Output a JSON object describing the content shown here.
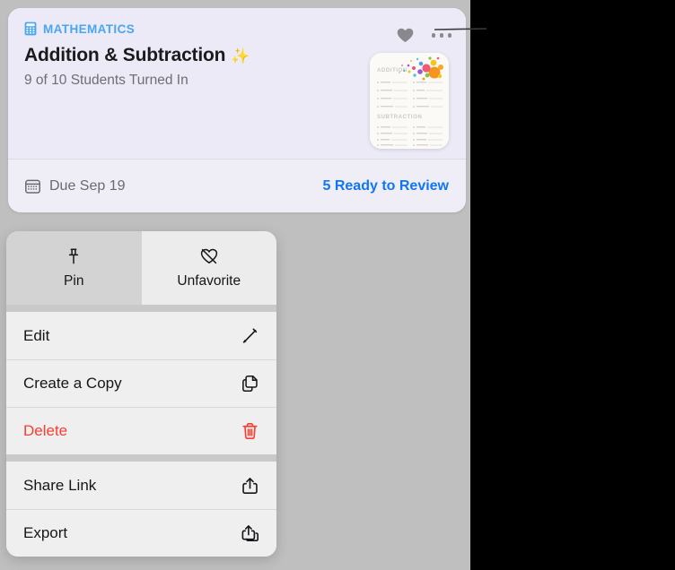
{
  "card": {
    "subject_icon": "calculator-icon",
    "subject": "MATHEMATICS",
    "title": "Addition & Subtraction",
    "title_emoji": "✨",
    "subtitle": "9 of 10 Students Turned In",
    "favorite_icon": "heart-icon",
    "more_icon": "ellipsis-icon",
    "footer": {
      "calendar_icon": "calendar-icon",
      "due": "Due Sep 19",
      "review_link": "5 Ready to Review"
    },
    "thumbnail": {
      "section_1": "ADDITION",
      "section_2": "SUBTRACTION"
    },
    "colors": {
      "background": "#eceaf6",
      "subject_blue": "#49a6f0",
      "link_blue": "#1175f5",
      "title": "#1b1b1d",
      "subtitle": "#6e6e73"
    }
  },
  "context_menu": {
    "tiles": [
      {
        "label": "Pin",
        "icon": "pin-icon",
        "selected": true
      },
      {
        "label": "Unfavorite",
        "icon": "heart-slash-icon",
        "selected": false
      }
    ],
    "group_1": [
      {
        "label": "Edit",
        "icon": "pencil-icon",
        "danger": false
      },
      {
        "label": "Create a Copy",
        "icon": "duplicate-icon",
        "danger": false
      },
      {
        "label": "Delete",
        "icon": "trash-icon",
        "danger": true
      }
    ],
    "group_2": [
      {
        "label": "Share Link",
        "icon": "share-icon",
        "danger": false
      },
      {
        "label": "Export",
        "icon": "export-icon",
        "danger": false
      }
    ],
    "colors": {
      "row_background": "#efefef",
      "tile_selected": "#d3d3d3",
      "danger": "#fa3c31"
    }
  },
  "callout": {
    "line_color": "#3a3a3a",
    "target_icon": "ellipsis-icon"
  }
}
